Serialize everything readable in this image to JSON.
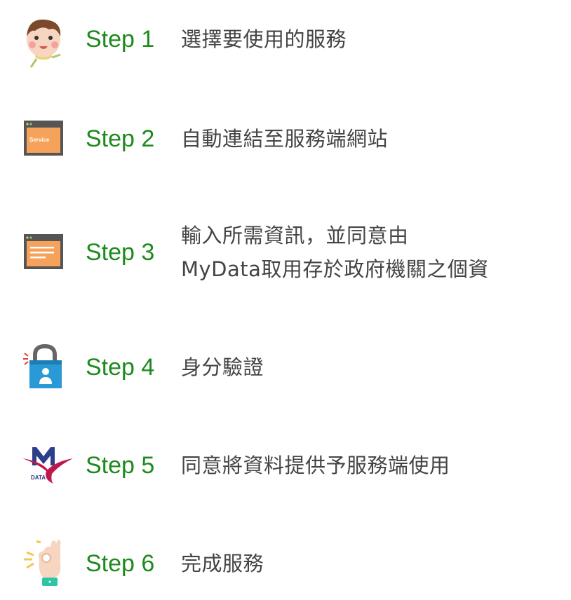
{
  "steps": [
    {
      "label": "Step 1",
      "text": "選擇要使用的服務",
      "icon": "person-face-icon"
    },
    {
      "label": "Step 2",
      "text": "自動連結至服務端網站",
      "icon": "service-window-icon",
      "icon_text": "Service"
    },
    {
      "label": "Step 3",
      "text_lines": [
        "輸入所需資訊，並同意由",
        "MyData取用存於政府機關之個資"
      ],
      "icon": "form-window-icon"
    },
    {
      "label": "Step 4",
      "text": "身分驗證",
      "icon": "padlock-user-icon"
    },
    {
      "label": "Step 5",
      "text": "同意將資料提供予服務端使用",
      "icon": "mydata-logo-icon",
      "icon_text": "DATA"
    },
    {
      "label": "Step 6",
      "text": "完成服務",
      "icon": "ok-hand-icon"
    }
  ],
  "colors": {
    "step_label": "#1e8a1e",
    "text": "#444444",
    "window_orange": "#f7a25a",
    "window_frame": "#555555",
    "lock_blue": "#2a9ad6",
    "mydata_red": "#c0174a",
    "mydata_navy": "#2c3e8a"
  }
}
